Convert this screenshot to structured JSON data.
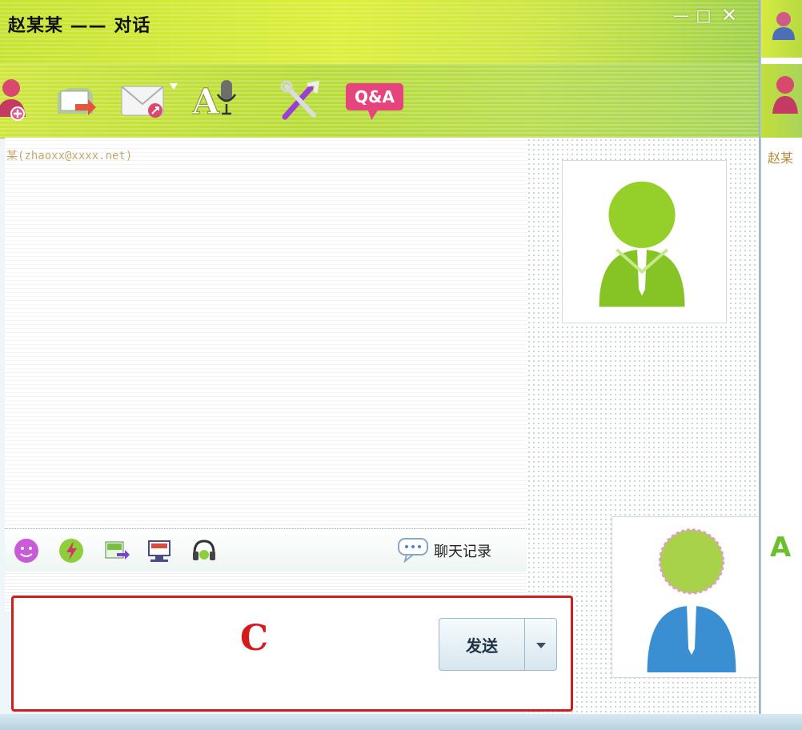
{
  "window": {
    "title": "赵某某 —— 对话",
    "controls": {
      "minimize": "—",
      "maximize": "□",
      "close": "✕"
    }
  },
  "toolbar": {
    "items": [
      {
        "icon": "add-contact-icon"
      },
      {
        "icon": "send-file-icon"
      },
      {
        "icon": "email-icon"
      },
      {
        "icon": "voice-chat-icon"
      },
      {
        "icon": "settings-tools-icon"
      },
      {
        "icon": "qa-icon",
        "label": "Q&A"
      }
    ]
  },
  "conversation": {
    "header": "某(zhaoxx@xxxx.net)"
  },
  "input_toolbar": {
    "items": [
      {
        "icon": "emoticon-icon"
      },
      {
        "icon": "nudge-icon"
      },
      {
        "icon": "send-image-icon"
      },
      {
        "icon": "screen-share-icon"
      },
      {
        "icon": "music-icon"
      }
    ],
    "history_label": "聊天记录"
  },
  "compose": {
    "marker": "C",
    "send_label": "发送"
  },
  "second_window": {
    "header_fragment": "赵某",
    "font_icon_label": "A"
  },
  "colors": {
    "title_bar": "#d4ea3a",
    "toolbar": "#bcdc40",
    "highlight_border": "#d21d1d",
    "avatar_green": "#8fcc2a",
    "avatar_blue": "#3a8fd3"
  }
}
